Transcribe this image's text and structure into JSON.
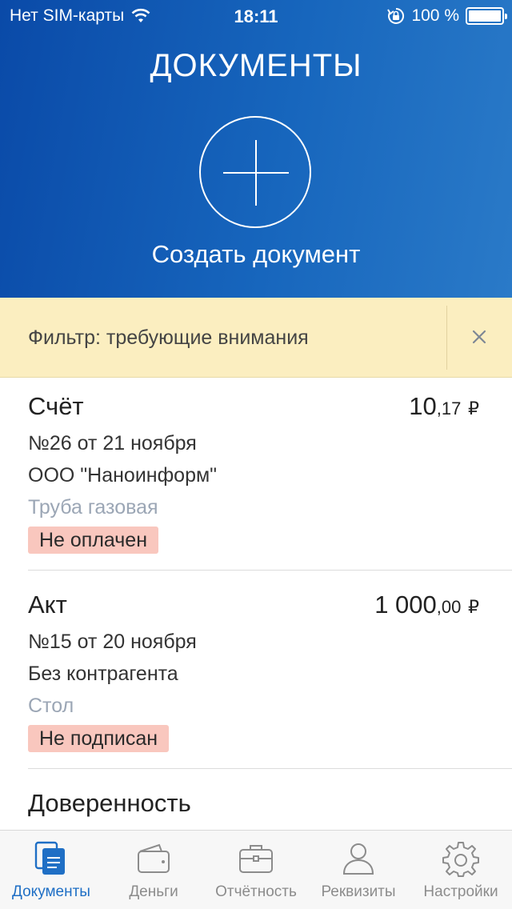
{
  "status_bar": {
    "carrier": "Нет SIM-карты",
    "time": "18:11",
    "battery": "100 %"
  },
  "header": {
    "title": "ДОКУМЕНТЫ",
    "create_label": "Создать документ"
  },
  "filter": {
    "label": "Фильтр: требующие внимания"
  },
  "documents": [
    {
      "type": "Счёт",
      "amount_main": "10",
      "amount_cents": ",17",
      "currency": "₽",
      "number": "№26 от 21 ноября",
      "counterparty": "ООО \"Наноинформ\"",
      "item": "Труба газовая",
      "status": "Не оплачен"
    },
    {
      "type": "Акт",
      "amount_main": "1 000",
      "amount_cents": ",00",
      "currency": "₽",
      "number": "№15 от 20 ноября",
      "counterparty": "Без контрагента",
      "item": "Стол",
      "status": "Не подписан"
    },
    {
      "type": "Доверенность"
    }
  ],
  "tabs": [
    {
      "label": "Документы",
      "icon": "documents-icon",
      "active": true
    },
    {
      "label": "Деньги",
      "icon": "wallet-icon",
      "active": false
    },
    {
      "label": "Отчётность",
      "icon": "briefcase-icon",
      "active": false
    },
    {
      "label": "Реквизиты",
      "icon": "person-icon",
      "active": false
    },
    {
      "label": "Настройки",
      "icon": "gear-icon",
      "active": false
    }
  ],
  "colors": {
    "header_gradient_start": "#0a4aa8",
    "header_gradient_end": "#2a7ac8",
    "filter_bg": "#fbeec0",
    "badge_bg": "#f9c7be",
    "tab_active": "#1f6fc5",
    "tab_inactive": "#8c8c8c"
  }
}
